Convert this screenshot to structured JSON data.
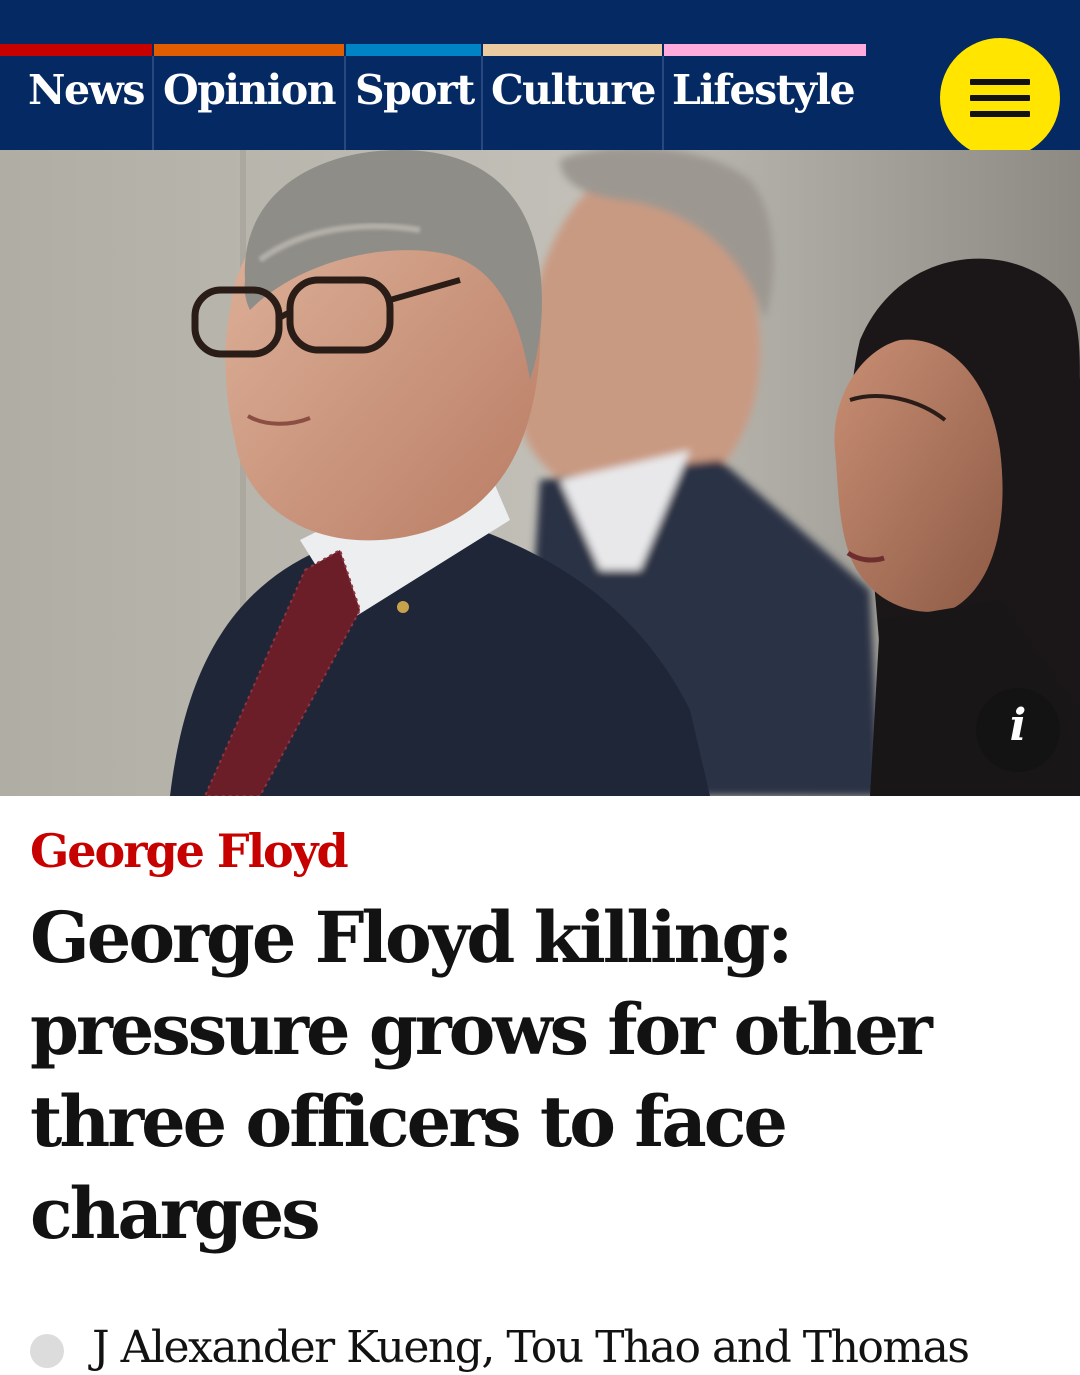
{
  "nav": {
    "items": [
      {
        "label": "News",
        "color": "#c70000"
      },
      {
        "label": "Opinion",
        "color": "#e05e00"
      },
      {
        "label": "Sport",
        "color": "#0084c6"
      },
      {
        "label": "Culture",
        "color": "#eacca0"
      },
      {
        "label": "Lifestyle",
        "color": "#ffabdb"
      }
    ],
    "menu_icon": "hamburger-menu-icon",
    "menu_color": "#ffe500",
    "bar_color": "#052962"
  },
  "hero": {
    "caption_icon": "info-icon",
    "info_glyph": "i"
  },
  "article": {
    "kicker": "George Floyd",
    "kicker_color": "#c70000",
    "headline": "George Floyd killing: pressure grows for other three officers to face charges",
    "standfirst_partial": "J Alexander Kueng, Tou Thao and Thomas"
  }
}
